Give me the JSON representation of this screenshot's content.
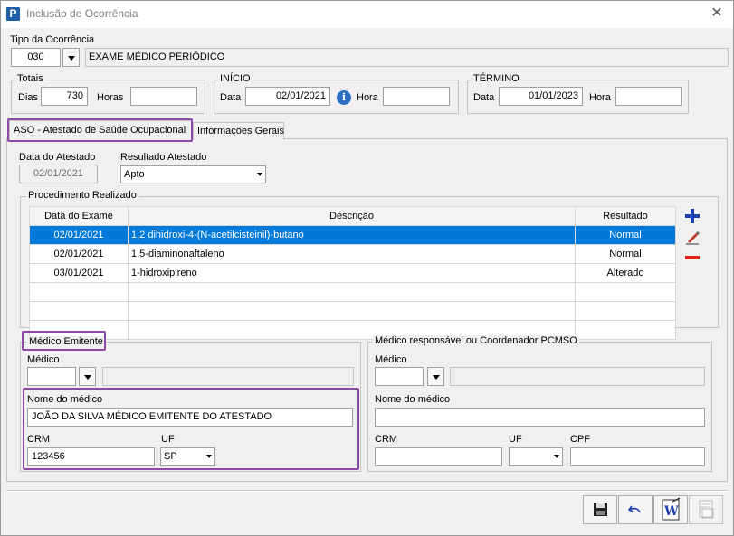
{
  "window": {
    "title": "Inclusão de Ocorrência",
    "app_icon_letter": "P"
  },
  "tipo": {
    "label": "Tipo da Ocorrência",
    "code": "030",
    "description": "EXAME MÉDICO PERIÓDICO"
  },
  "totais": {
    "group": "Totais",
    "dias_label": "Dias",
    "dias_value": "730",
    "horas_label": "Horas",
    "horas_value": ""
  },
  "inicio": {
    "group": "INÍCIO",
    "data_label": "Data",
    "data_value": "02/01/2021",
    "hora_label": "Hora",
    "hora_value": ""
  },
  "termino": {
    "group": "TÉRMINO",
    "data_label": "Data",
    "data_value": "01/01/2023",
    "hora_label": "Hora",
    "hora_value": ""
  },
  "tabs": [
    {
      "label": "ASO - Atestado de Saúde Ocupacional",
      "active": true
    },
    {
      "label": "Informações Gerais",
      "active": false
    }
  ],
  "atestado": {
    "data_label": "Data do Atestado",
    "data_value": "02/01/2021",
    "resultado_label": "Resultado Atestado",
    "resultado_value": "Apto"
  },
  "procedimento": {
    "group": "Procedimento Realizado",
    "columns": [
      "Data do Exame",
      "Descrição",
      "Resultado"
    ],
    "rows": [
      {
        "data": "02/01/2021",
        "descricao": "1,2 dihidroxi-4-(N-acetilcisteinil)-butano",
        "resultado": "Normal"
      },
      {
        "data": "02/01/2021",
        "descricao": "1,5-diaminonaftaleno",
        "resultado": "Normal"
      },
      {
        "data": "03/01/2021",
        "descricao": "1-hidroxipireno",
        "resultado": "Alterado"
      }
    ],
    "icons": [
      "add-icon",
      "edit-pencil-icon",
      "remove-icon"
    ]
  },
  "medico_emitente": {
    "group": "Médico Emitente",
    "medico_label": "Médico",
    "medico_value": "",
    "nome_label": "Nome do médico",
    "nome_value": "JOÃO DA SILVA MÉDICO EMITENTE DO ATESTADO",
    "crm_label": "CRM",
    "crm_value": "123456",
    "uf_label": "UF",
    "uf_value": "SP"
  },
  "medico_responsavel": {
    "group": "Médico responsável ou Coordenador PCMSO",
    "medico_label": "Médico",
    "medico_value": "",
    "nome_label": "Nome do médico",
    "nome_value": "",
    "crm_label": "CRM",
    "crm_value": "",
    "uf_label": "UF",
    "uf_value": "",
    "cpf_label": "CPF",
    "cpf_value": ""
  },
  "footer_buttons": [
    "save-icon",
    "undo-icon",
    "word-document-icon",
    "print-report-icon"
  ],
  "colors": {
    "highlight": "#8e4aa6",
    "selected_row": "#0078d7",
    "accent_blue": "#1f5fa8",
    "remove_red": "#e0241b"
  }
}
